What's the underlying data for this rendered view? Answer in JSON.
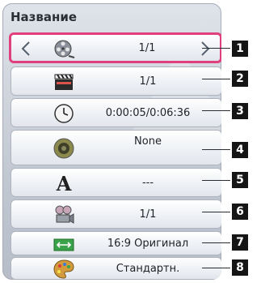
{
  "panel": {
    "title": "Название"
  },
  "rows": [
    {
      "icon": "film-reel-icon",
      "value": "1/1",
      "callout": "1"
    },
    {
      "icon": "clapperboard-icon",
      "value": "1/1",
      "callout": "2"
    },
    {
      "icon": "clock-icon",
      "value": "0:00:05/0:06:36",
      "callout": "3"
    },
    {
      "icon": "speaker-icon",
      "value": "None",
      "callout": "4"
    },
    {
      "icon": "subtitle-letter-icon",
      "value": "---",
      "callout": "5"
    },
    {
      "icon": "camera-angle-icon",
      "value": "1/1",
      "callout": "6"
    },
    {
      "icon": "aspect-ratio-icon",
      "value": "16:9 Оригинал",
      "callout": "7"
    },
    {
      "icon": "palette-icon",
      "value": "Стандартн.",
      "callout": "8"
    }
  ],
  "colors": {
    "highlight": "#e0407d",
    "panel": "#c3c9d3",
    "callout": "#151515"
  }
}
